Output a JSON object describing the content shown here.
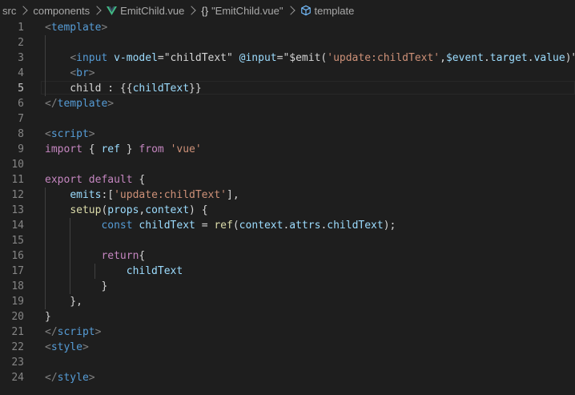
{
  "breadcrumb": {
    "items": [
      "src",
      "components",
      "EmitChild.vue",
      "\"EmitChild.vue\"",
      "template"
    ],
    "braces": "{}"
  },
  "current_line": 5,
  "colors": {
    "background": "#1e1e1e",
    "tag": "#569cd6",
    "attribute": "#9cdcfe",
    "string": "#ce9178",
    "keyword": "#c586c0",
    "function": "#dcdcaa",
    "vue_logo": "#41b883"
  },
  "lines": [
    {
      "n": "1",
      "guides": 0,
      "tokens": [
        {
          "c": "t-punc",
          "t": "<"
        },
        {
          "c": "t-tag",
          "t": "template"
        },
        {
          "c": "t-punc",
          "t": ">"
        }
      ]
    },
    {
      "n": "2",
      "guides": 1,
      "tokens": []
    },
    {
      "n": "3",
      "guides": 1,
      "tokens": [
        {
          "c": "t-plain",
          "t": "    "
        },
        {
          "c": "t-punc",
          "t": "<"
        },
        {
          "c": "t-tag",
          "t": "input"
        },
        {
          "c": "t-plain",
          "t": " "
        },
        {
          "c": "t-attr",
          "t": "v-model"
        },
        {
          "c": "t-plain",
          "t": "="
        },
        {
          "c": "t-plain",
          "t": "\"childText\""
        },
        {
          "c": "t-plain",
          "t": " "
        },
        {
          "c": "t-attr",
          "t": "@input"
        },
        {
          "c": "t-plain",
          "t": "=\""
        },
        {
          "c": "t-plain",
          "t": "$emit("
        },
        {
          "c": "t-str",
          "t": "'update:childText'"
        },
        {
          "c": "t-plain",
          "t": ","
        },
        {
          "c": "t-var",
          "t": "$event"
        },
        {
          "c": "t-plain",
          "t": "."
        },
        {
          "c": "t-var",
          "t": "target"
        },
        {
          "c": "t-plain",
          "t": "."
        },
        {
          "c": "t-var",
          "t": "value"
        },
        {
          "c": "t-plain",
          "t": ")\""
        },
        {
          "c": "t-punc",
          "t": ">"
        }
      ]
    },
    {
      "n": "4",
      "guides": 1,
      "tokens": [
        {
          "c": "t-plain",
          "t": "    "
        },
        {
          "c": "t-punc",
          "t": "<"
        },
        {
          "c": "t-tag",
          "t": "br"
        },
        {
          "c": "t-punc",
          "t": ">"
        }
      ]
    },
    {
      "n": "5",
      "guides": 1,
      "tokens": [
        {
          "c": "t-plain",
          "t": "    child : {{"
        },
        {
          "c": "t-var",
          "t": "childText"
        },
        {
          "c": "t-plain",
          "t": "}}"
        }
      ]
    },
    {
      "n": "6",
      "guides": 0,
      "tokens": [
        {
          "c": "t-punc",
          "t": "</"
        },
        {
          "c": "t-tag",
          "t": "template"
        },
        {
          "c": "t-punc",
          "t": ">"
        }
      ]
    },
    {
      "n": "7",
      "guides": 0,
      "tokens": []
    },
    {
      "n": "8",
      "guides": 0,
      "tokens": [
        {
          "c": "t-punc",
          "t": "<"
        },
        {
          "c": "t-tag",
          "t": "script"
        },
        {
          "c": "t-punc",
          "t": ">"
        }
      ]
    },
    {
      "n": "9",
      "guides": 0,
      "tokens": [
        {
          "c": "t-key",
          "t": "import"
        },
        {
          "c": "t-plain",
          "t": " { "
        },
        {
          "c": "t-var",
          "t": "ref"
        },
        {
          "c": "t-plain",
          "t": " } "
        },
        {
          "c": "t-key",
          "t": "from"
        },
        {
          "c": "t-plain",
          "t": " "
        },
        {
          "c": "t-str",
          "t": "'vue'"
        }
      ]
    },
    {
      "n": "10",
      "guides": 0,
      "tokens": []
    },
    {
      "n": "11",
      "guides": 0,
      "tokens": [
        {
          "c": "t-key",
          "t": "export"
        },
        {
          "c": "t-plain",
          "t": " "
        },
        {
          "c": "t-key",
          "t": "default"
        },
        {
          "c": "t-plain",
          "t": " {"
        }
      ]
    },
    {
      "n": "12",
      "guides": 1,
      "tokens": [
        {
          "c": "t-plain",
          "t": "    "
        },
        {
          "c": "t-var",
          "t": "emits"
        },
        {
          "c": "t-plain",
          "t": ":["
        },
        {
          "c": "t-str",
          "t": "'update:childText'"
        },
        {
          "c": "t-plain",
          "t": "],"
        }
      ]
    },
    {
      "n": "13",
      "guides": 1,
      "tokens": [
        {
          "c": "t-plain",
          "t": "    "
        },
        {
          "c": "t-fn",
          "t": "setup"
        },
        {
          "c": "t-plain",
          "t": "("
        },
        {
          "c": "t-var",
          "t": "props"
        },
        {
          "c": "t-plain",
          "t": ","
        },
        {
          "c": "t-var",
          "t": "context"
        },
        {
          "c": "t-plain",
          "t": ") {"
        }
      ]
    },
    {
      "n": "14",
      "guides": 2,
      "tokens": [
        {
          "c": "t-plain",
          "t": "         "
        },
        {
          "c": "t-dec",
          "t": "const"
        },
        {
          "c": "t-plain",
          "t": " "
        },
        {
          "c": "t-var",
          "t": "childText"
        },
        {
          "c": "t-plain",
          "t": " = "
        },
        {
          "c": "t-fn",
          "t": "ref"
        },
        {
          "c": "t-plain",
          "t": "("
        },
        {
          "c": "t-var",
          "t": "context"
        },
        {
          "c": "t-plain",
          "t": "."
        },
        {
          "c": "t-var",
          "t": "attrs"
        },
        {
          "c": "t-plain",
          "t": "."
        },
        {
          "c": "t-var",
          "t": "childText"
        },
        {
          "c": "t-plain",
          "t": ");"
        }
      ]
    },
    {
      "n": "15",
      "guides": 2,
      "tokens": []
    },
    {
      "n": "16",
      "guides": 2,
      "tokens": [
        {
          "c": "t-plain",
          "t": "         "
        },
        {
          "c": "t-key",
          "t": "return"
        },
        {
          "c": "t-plain",
          "t": "{"
        }
      ]
    },
    {
      "n": "17",
      "guides": 3,
      "tokens": [
        {
          "c": "t-plain",
          "t": "             "
        },
        {
          "c": "t-var",
          "t": "childText"
        }
      ]
    },
    {
      "n": "18",
      "guides": 2,
      "tokens": [
        {
          "c": "t-plain",
          "t": "         }"
        }
      ]
    },
    {
      "n": "19",
      "guides": 1,
      "tokens": [
        {
          "c": "t-plain",
          "t": "    },"
        }
      ]
    },
    {
      "n": "20",
      "guides": 0,
      "tokens": [
        {
          "c": "t-plain",
          "t": "}"
        }
      ]
    },
    {
      "n": "21",
      "guides": 0,
      "tokens": [
        {
          "c": "t-punc",
          "t": "</"
        },
        {
          "c": "t-tag",
          "t": "script"
        },
        {
          "c": "t-punc",
          "t": ">"
        }
      ]
    },
    {
      "n": "22",
      "guides": 0,
      "tokens": [
        {
          "c": "t-punc",
          "t": "<"
        },
        {
          "c": "t-tag",
          "t": "style"
        },
        {
          "c": "t-punc",
          "t": ">"
        }
      ]
    },
    {
      "n": "23",
      "guides": 0,
      "tokens": []
    },
    {
      "n": "24",
      "guides": 0,
      "tokens": [
        {
          "c": "t-punc",
          "t": "</"
        },
        {
          "c": "t-tag",
          "t": "style"
        },
        {
          "c": "t-punc",
          "t": ">"
        }
      ]
    }
  ]
}
